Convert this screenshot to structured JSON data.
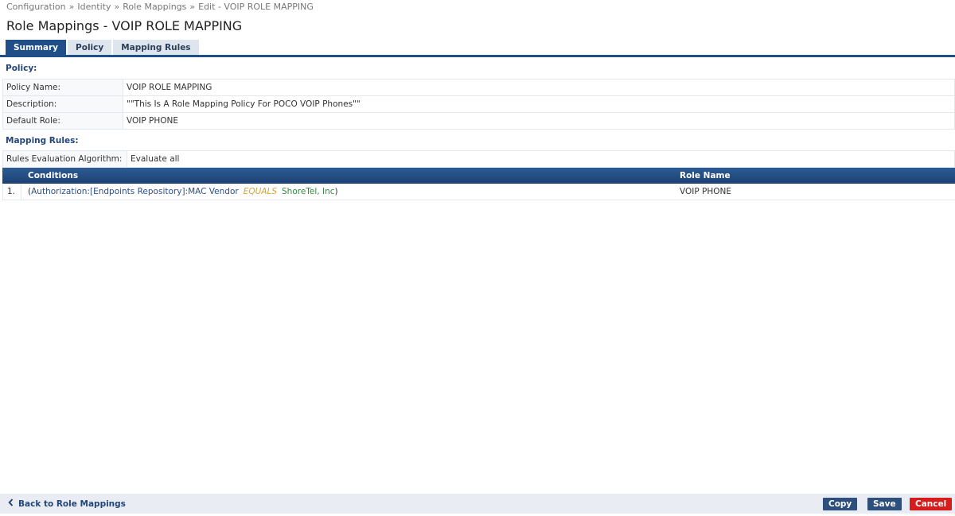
{
  "breadcrumb": [
    "Configuration",
    "Identity",
    "Role Mappings",
    "Edit - VOIP ROLE MAPPING"
  ],
  "breadcrumb_separator": "»",
  "page_title": "Role Mappings - VOIP ROLE MAPPING",
  "tabs": [
    {
      "label": "Summary",
      "active": true
    },
    {
      "label": "Policy",
      "active": false
    },
    {
      "label": "Mapping Rules",
      "active": false
    }
  ],
  "policy": {
    "heading": "Policy:",
    "name_label": "Policy Name:",
    "name_value": "VOIP ROLE MAPPING",
    "description_label": "Description:",
    "description_value": "\"\"This Is A Role Mapping Policy For POCO VOIP Phones\"\"",
    "default_role_label": "Default Role:",
    "default_role_value": "VOIP PHONE"
  },
  "mapping_rules": {
    "heading": "Mapping Rules:",
    "algorithm_label": "Rules Evaluation Algorithm:",
    "algorithm_value": "Evaluate all",
    "columns": {
      "conditions": "Conditions",
      "role_name": "Role Name"
    },
    "rows": [
      {
        "number": "1.",
        "open_paren": "(",
        "attribute": "Authorization:[Endpoints Repository]:MAC Vendor",
        "operator": "EQUALS",
        "value": "ShoreTel, Inc",
        "close_paren": ")",
        "role": "VOIP PHONE"
      }
    ]
  },
  "footer": {
    "back_label": "Back to Role Mappings",
    "back_icon": "chevron-left-icon",
    "copy_label": "Copy",
    "save_label": "Save",
    "cancel_label": "Cancel"
  },
  "colors": {
    "primary": "#1f4e88",
    "cancel": "#d81c1c",
    "operator": "#d9a13a",
    "value": "#2e8a3c"
  }
}
